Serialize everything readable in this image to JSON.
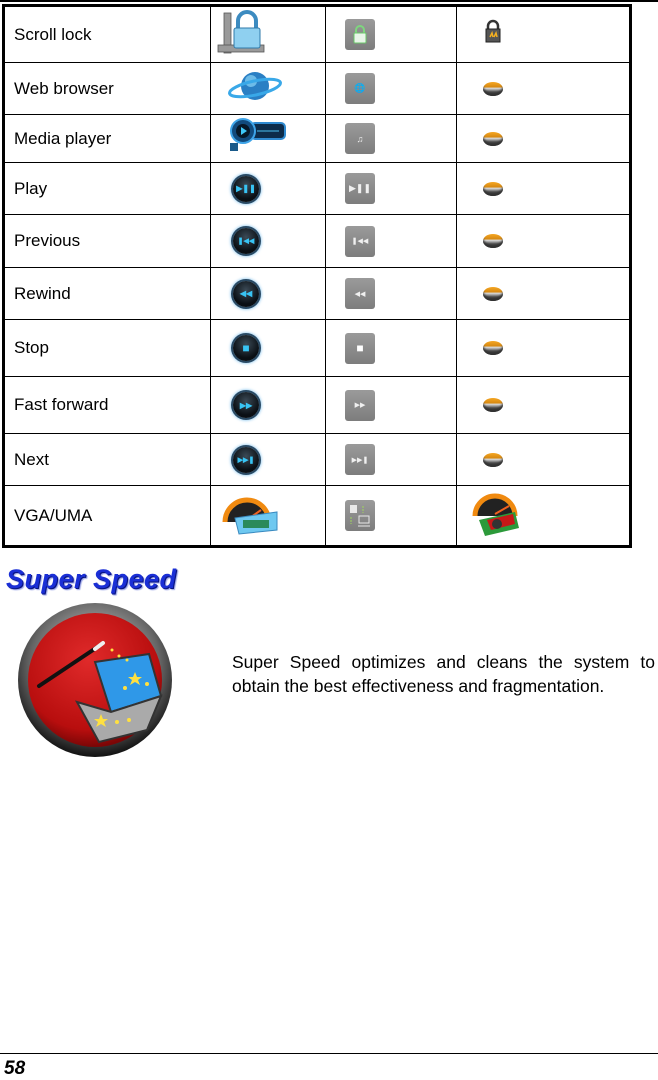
{
  "table": {
    "rows": [
      {
        "label": "Scroll lock",
        "icons": [
          "scroll-lock-color-icon",
          "lock-gray-icon",
          "lock-disk-icon"
        ],
        "gray_glyph": "🔒",
        "round_glyph": ""
      },
      {
        "label": "Web browser",
        "icons": [
          "globe-color-icon",
          "globe-gray-icon",
          "globe-disk-icon"
        ],
        "gray_glyph": "🌐",
        "round_glyph": ""
      },
      {
        "label": "Media player",
        "icons": [
          "media-player-color-icon",
          "media-player-gray-icon",
          "media-player-disk-icon"
        ],
        "gray_glyph": "♫",
        "round_glyph": ""
      },
      {
        "label": "Play",
        "icons": [
          "play-pause-round-icon",
          "play-pause-gray-icon",
          "play-pause-disk-icon"
        ],
        "gray_glyph": "▶❚❚",
        "round_glyph": "▶❚❚"
      },
      {
        "label": "Previous",
        "icons": [
          "previous-round-icon",
          "previous-gray-icon",
          "previous-disk-icon"
        ],
        "gray_glyph": "❚◀◀",
        "round_glyph": "❚◀◀"
      },
      {
        "label": "Rewind",
        "icons": [
          "rewind-round-icon",
          "rewind-gray-icon",
          "rewind-disk-icon"
        ],
        "gray_glyph": "◀◀",
        "round_glyph": "◀◀"
      },
      {
        "label": "Stop",
        "icons": [
          "stop-round-icon",
          "stop-gray-icon",
          "stop-disk-icon"
        ],
        "gray_glyph": "■",
        "round_glyph": "■"
      },
      {
        "label": "Fast forward",
        "icons": [
          "fast-forward-round-icon",
          "fast-forward-gray-icon",
          "fast-forward-disk-icon"
        ],
        "gray_glyph": "▶▶",
        "round_glyph": "▶▶"
      },
      {
        "label": "Next",
        "icons": [
          "next-round-icon",
          "next-gray-icon",
          "next-disk-icon"
        ],
        "gray_glyph": "▶▶❚",
        "round_glyph": "▶▶❚"
      },
      {
        "label": "VGA/UMA",
        "icons": [
          "vga-speedometer-color-icon",
          "vga-uma-gray-icon",
          "vga-speedometer-graphics-card-icon"
        ],
        "gray_glyph": "⊞",
        "round_glyph": ""
      }
    ]
  },
  "section": {
    "title": "Super Speed",
    "icon": "super-speed-magic-wand-laptop-icon",
    "description": "Super Speed optimizes and cleans the system to obtain the best effectiveness and fragmentation."
  },
  "footer": {
    "page_number": "58"
  },
  "colors": {
    "title_blue": "#1a2fd6",
    "icon_gray": "#8a8a8a",
    "media_cyan": "#38c4f4",
    "super_speed_red": "#d01010"
  }
}
